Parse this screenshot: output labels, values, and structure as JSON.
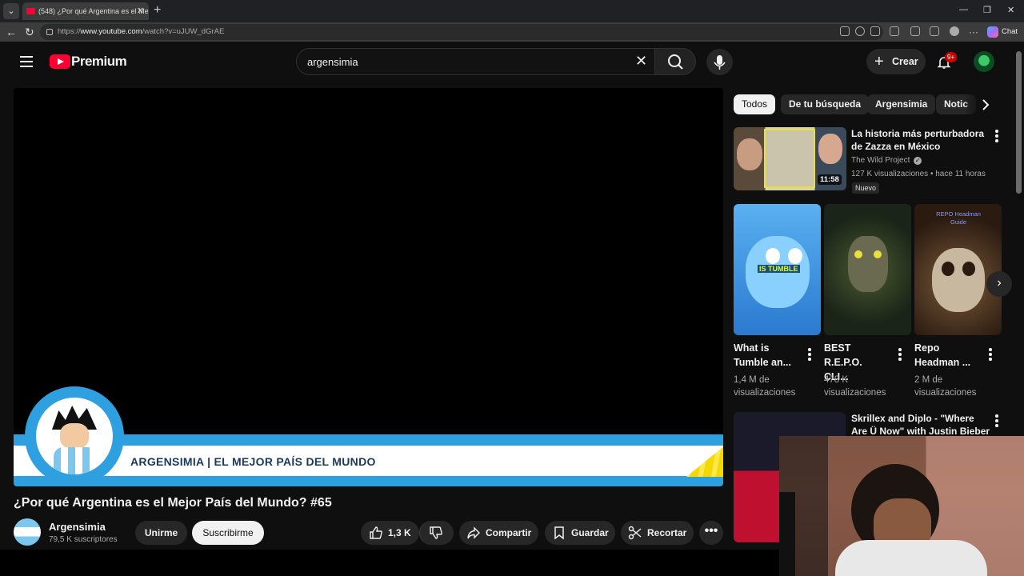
{
  "browser": {
    "tab_title": "(548) ¿Por qué Argentina es el Me",
    "tab_close": "✕",
    "new_tab": "+",
    "url_prefix": "https://",
    "url_host": "www.youtube.com",
    "url_path": "/watch?v=uJUW_dGrAE",
    "chat_label": "Chat",
    "window_controls": [
      "—",
      "❐",
      "✕"
    ]
  },
  "masthead": {
    "brand": "Premium",
    "search_value": "argensimia",
    "search_clear": "✕",
    "create_label": "Crear",
    "create_plus": "+",
    "notifications_badge": "9+"
  },
  "player": {
    "banner_text": "ARGENSIMIA | EL MEJOR PAÍS DEL MUNDO"
  },
  "video": {
    "title": "¿Por qué Argentina es el Mejor País del Mundo? #65",
    "channel_name": "Argensimia",
    "subscribers": "79,5 K suscriptores",
    "join_label": "Unirme",
    "subscribe_label": "Suscribirme",
    "likes": "1,3 K",
    "share_label": "Compartir",
    "save_label": "Guardar",
    "clip_label": "Recortar"
  },
  "chips": [
    "Todos",
    "De tu búsqueda",
    "Argensimia",
    "Notic"
  ],
  "sidebar": {
    "video1": {
      "title": "La historia más perturbadora de Zazza en México",
      "channel": "The Wild Project",
      "meta": "127 K visualizaciones • hace 11 horas",
      "duration": "11:58",
      "badge": "Nuevo"
    },
    "shorts": [
      {
        "title": "What is Tumble an...",
        "views": "1,4 M de visualizaciones",
        "overlay": "IS TUMBLE"
      },
      {
        "title": "BEST R.E.P.O. CLI...",
        "views": "478 K visualizaciones",
        "overlay": ""
      },
      {
        "title": "Repo Headman ...",
        "views": "2 M de visualizaciones",
        "overlay": "REPO Headman Guide"
      }
    ],
    "video2": {
      "title": "Skrillex and Diplo - \"Where Are Ü Now\" with Justin Bieber ..."
    }
  },
  "colors": {
    "brand_red": "#ff0033",
    "banner_blue": "#2ea0e0",
    "background": "#0f0f0f"
  }
}
